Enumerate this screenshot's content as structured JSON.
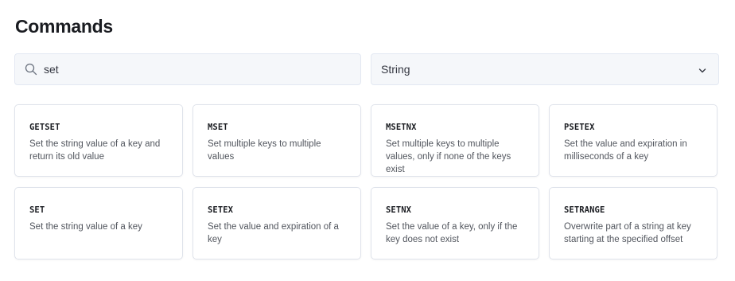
{
  "page": {
    "title": "Commands"
  },
  "search": {
    "value": "set",
    "icon": "search-icon"
  },
  "filter": {
    "selected": "String",
    "icon": "chevron-down-icon"
  },
  "commands": [
    {
      "name": "GETSET",
      "description": "Set the string value of a key and return its old value"
    },
    {
      "name": "MSET",
      "description": "Set multiple keys to multiple values"
    },
    {
      "name": "MSETNX",
      "description": "Set multiple keys to multiple values, only if none of the keys exist"
    },
    {
      "name": "PSETEX",
      "description": "Set the value and expiration in milliseconds of a key"
    },
    {
      "name": "SET",
      "description": "Set the string value of a key"
    },
    {
      "name": "SETEX",
      "description": "Set the value and expiration of a key"
    },
    {
      "name": "SETNX",
      "description": "Set the value of a key, only if the key does not exist"
    },
    {
      "name": "SETRANGE",
      "description": "Overwrite part of a string at key starting at the specified offset"
    }
  ],
  "colors": {
    "accent": "#1a1c21",
    "field_bg": "#f5f7fa",
    "border": "#dfe3eb"
  }
}
